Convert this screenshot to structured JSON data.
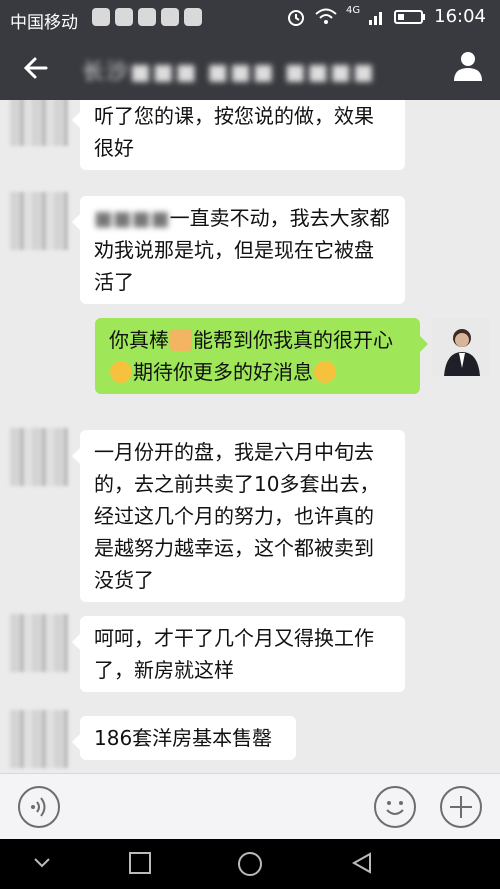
{
  "status_bar": {
    "carrier": "中国移动",
    "network": "4G",
    "time": "16:04"
  },
  "header": {
    "title": "长沙■■■ ■■■ ■■■■ ■■■■"
  },
  "messages": [
    {
      "from": "other",
      "text": "听了您的课，按您说的做，效果很好"
    },
    {
      "from": "other",
      "name_blurred": "■■■■",
      "text": "一直卖不动，我去大家都劝我说那是坑，但是现在它被盘活了"
    },
    {
      "from": "me",
      "part1": "你真棒",
      "part2": "能帮到你我真的很开心",
      "part3": "期待你更多的好消息"
    },
    {
      "from": "other",
      "text": "一月份开的盘，我是六月中旬去的，去之前共卖了10多套出去，经过这几个月的努力，也许真的是越努力越幸运，这个都被卖到没货了"
    },
    {
      "from": "other",
      "text": "呵呵，才干了几个月又得换工作了，新房就这样"
    },
    {
      "from": "other",
      "text": "186套洋房基本售罄"
    }
  ],
  "icons": {
    "back": "back-arrow-icon",
    "profile": "person-icon",
    "voice": "voice-icon",
    "emoji": "emoji-icon",
    "add": "plus-icon",
    "nav_back": "triangle-back-icon",
    "nav_home": "circle-home-icon",
    "nav_recent": "square-recent-icon"
  }
}
